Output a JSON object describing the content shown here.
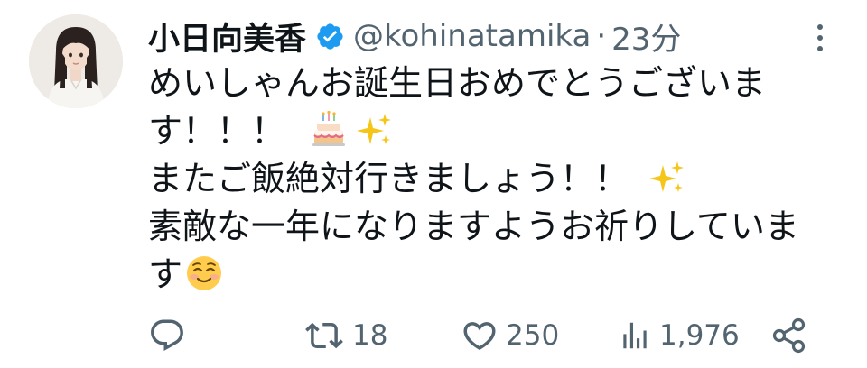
{
  "author": {
    "display_name": "小日向美香",
    "handle": "@kohinatamika",
    "separator": "·",
    "time": "23分",
    "verified_icon": "verified-badge-icon"
  },
  "tweet": {
    "lines": [
      "めいしゃんお誕生日おめでとうございま",
      "す！！！",
      "またご飯絶対行きましょう！！",
      "素敵な一年になりますようお祈りしていま",
      "す"
    ],
    "emoji": [
      "birthday-cake",
      "sparkles",
      "sparkles",
      "smiling-face"
    ]
  },
  "actions": {
    "reply": {
      "icon": "reply-icon",
      "count": ""
    },
    "retweet": {
      "icon": "retweet-icon",
      "count": "18"
    },
    "like": {
      "icon": "heart-icon",
      "count": "250"
    },
    "views": {
      "icon": "views-chart-icon",
      "count": "1,976"
    },
    "share": {
      "icon": "share-icon"
    }
  },
  "colors": {
    "text": "#0f1419",
    "secondary": "#536471",
    "verified": "#1d9bf0"
  }
}
